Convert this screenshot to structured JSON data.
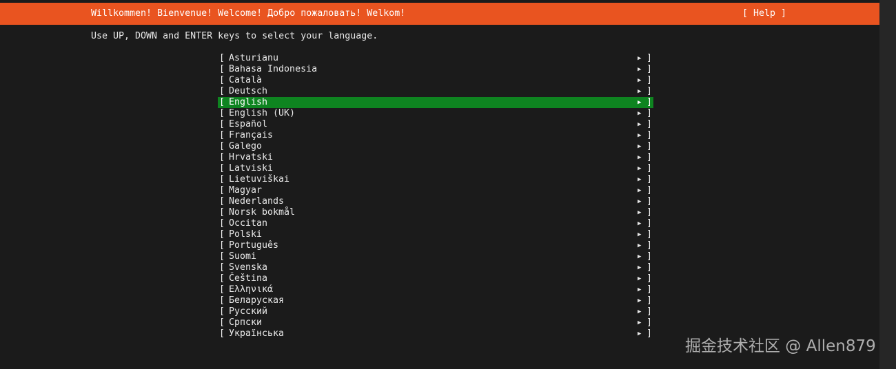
{
  "header": {
    "title": "Willkommen! Bienvenue! Welcome! Добро пожаловать! Welkom!",
    "help_label": "[ Help ]"
  },
  "instructions": "Use UP, DOWN and ENTER keys to select your language.",
  "colors": {
    "header_bg": "#e95420",
    "selected_bg": "#0e8420",
    "background": "#1b1b1b"
  },
  "list": {
    "bracket_open": "[",
    "bracket_close": "]",
    "arrow_icon": "▶",
    "selected_label": "English",
    "items": [
      {
        "label": "Asturianu"
      },
      {
        "label": "Bahasa Indonesia"
      },
      {
        "label": "Català"
      },
      {
        "label": "Deutsch"
      },
      {
        "label": "English"
      },
      {
        "label": "English (UK)"
      },
      {
        "label": "Español"
      },
      {
        "label": "Français"
      },
      {
        "label": "Galego"
      },
      {
        "label": "Hrvatski"
      },
      {
        "label": "Latviski"
      },
      {
        "label": "Lietuviškai"
      },
      {
        "label": "Magyar"
      },
      {
        "label": "Nederlands"
      },
      {
        "label": "Norsk bokmål"
      },
      {
        "label": "Occitan"
      },
      {
        "label": "Polski"
      },
      {
        "label": "Português"
      },
      {
        "label": "Suomi"
      },
      {
        "label": "Svenska"
      },
      {
        "label": "Čeština"
      },
      {
        "label": "Ελληνικά"
      },
      {
        "label": "Беларуская"
      },
      {
        "label": "Русский"
      },
      {
        "label": "Српски"
      },
      {
        "label": "Українська"
      }
    ]
  },
  "watermark": "掘金技术社区 @ Allen879"
}
